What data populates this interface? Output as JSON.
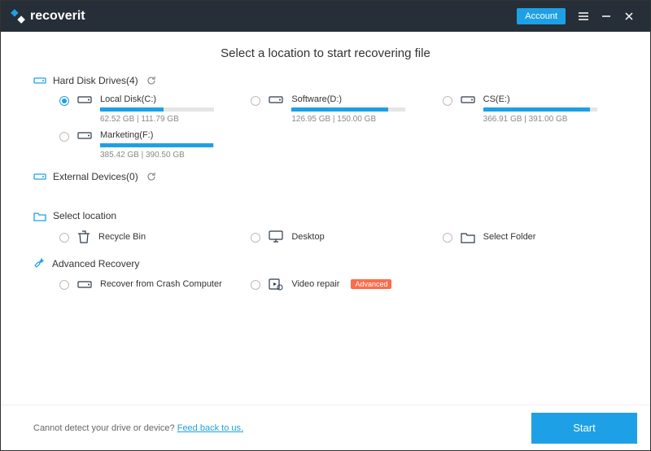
{
  "app": {
    "name": "recoverit"
  },
  "titlebar": {
    "account_label": "Account"
  },
  "page": {
    "title": "Select a location to start recovering file"
  },
  "sections": {
    "hdd": {
      "label": "Hard Disk Drives(4)"
    },
    "ext": {
      "label": "External Devices(0)"
    },
    "loc": {
      "label": "Select location"
    },
    "adv": {
      "label": "Advanced Recovery"
    }
  },
  "drives": [
    {
      "name": "Local Disk(C:)",
      "used": 62.52,
      "total": 111.79,
      "size_text": "62.52  GB | 111.79  GB",
      "selected": true,
      "fill_pct": 56
    },
    {
      "name": "Software(D:)",
      "used": 126.95,
      "total": 150.0,
      "size_text": "126.95  GB | 150.00  GB",
      "selected": false,
      "fill_pct": 85
    },
    {
      "name": "CS(E:)",
      "used": 366.91,
      "total": 391.0,
      "size_text": "366.91  GB | 391.00  GB",
      "selected": false,
      "fill_pct": 94
    },
    {
      "name": "Marketing(F:)",
      "used": 385.42,
      "total": 390.5,
      "size_text": "385.42  GB | 390.50  GB",
      "selected": false,
      "fill_pct": 99
    }
  ],
  "locations": [
    {
      "name": "Recycle Bin",
      "icon": "recycle-bin"
    },
    {
      "name": "Desktop",
      "icon": "desktop"
    },
    {
      "name": "Select Folder",
      "icon": "folder"
    }
  ],
  "advanced": [
    {
      "name": "Recover from Crash Computer",
      "icon": "drive",
      "badge": null
    },
    {
      "name": "Video repair",
      "icon": "video-repair",
      "badge": "Advanced"
    }
  ],
  "footer": {
    "text": "Cannot detect your drive or device? ",
    "link": "Feed back to us.",
    "start_label": "Start"
  },
  "colors": {
    "accent": "#1ea0e6",
    "titlebar": "#262e37",
    "badge": "#ff6b4a"
  }
}
